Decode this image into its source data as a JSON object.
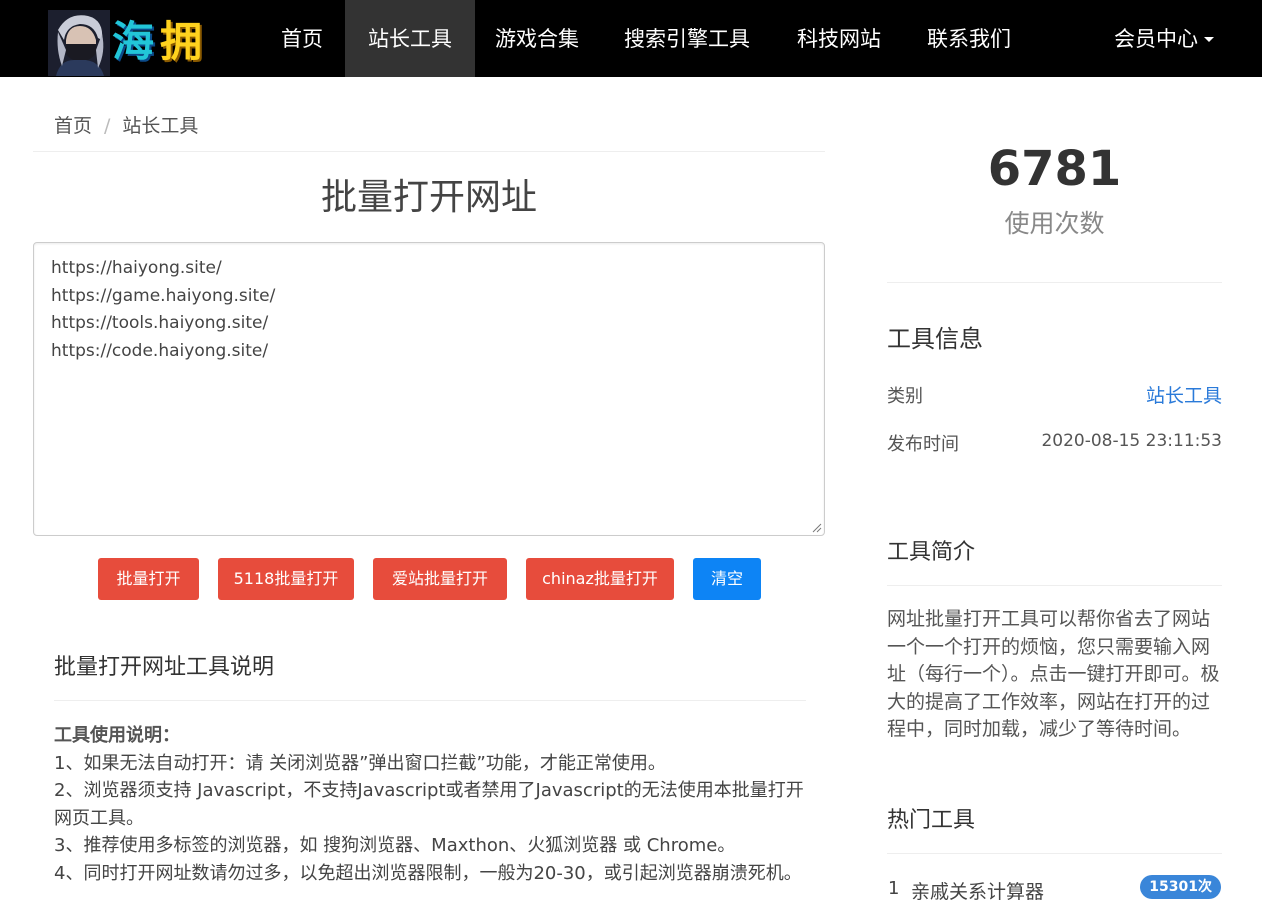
{
  "nav": {
    "logo_text_1": "海",
    "logo_text_2": "拥",
    "items": [
      "首页",
      "站长工具",
      "游戏合集",
      "搜索引擎工具",
      "科技网站",
      "联系我们"
    ],
    "member": "会员中心"
  },
  "breadcrumb": {
    "home": "首页",
    "current": "站长工具"
  },
  "main": {
    "title": "批量打开网址",
    "urls": "https://haiyong.site/\nhttps://game.haiyong.site/\nhttps://tools.haiyong.site/\nhttps://code.haiyong.site/",
    "buttons": {
      "open": "批量打开",
      "open_5118": "5118批量打开",
      "open_aizhan": "爱站批量打开",
      "open_chinaz": "chinaz批量打开",
      "clear": "清空"
    },
    "guide_title": "批量打开网址工具说明",
    "guide_heading": "工具使用说明：",
    "guide_lines": [
      "1、如果无法自动打开：请 关闭浏览器”弹出窗口拦截”功能，才能正常使用。",
      "2、浏览器须支持 Javascript，不支持Javascript或者禁用了Javascript的无法使用本批量打开网页工具。",
      "3、推荐使用多标签的浏览器，如 搜狗浏览器、Maxthon、火狐浏览器 或 Chrome。",
      "4、同时打开网址数请勿过多，以免超出浏览器限制，一般为20-30，或引起浏览器崩溃死机。"
    ]
  },
  "sidebar": {
    "count": "6781",
    "count_label": "使用次数",
    "info_title": "工具信息",
    "category_label": "类别",
    "category_value": "站长工具",
    "date_label": "发布时间",
    "date_value": "2020-08-15 23:11:53",
    "intro_title": "工具简介",
    "intro_text": "网址批量打开工具可以帮你省去了网站一个一个打开的烦恼，您只需要输入网址（每行一个）。点击一键打开即可。极大的提高了工作效率，网站在打开的过程中，同时加载，减少了等待时间。",
    "hot_title": "热门工具",
    "hot_items": [
      {
        "rank": "1",
        "name": "亲戚关系计算器",
        "count": "15301次"
      }
    ]
  },
  "colors": {
    "nav_bg": "#000000",
    "nav_active": "#333333",
    "btn_red": "#e74c3c",
    "btn_blue": "#0d84f5",
    "link": "#2a7ad9",
    "badge": "#3a86d9"
  }
}
